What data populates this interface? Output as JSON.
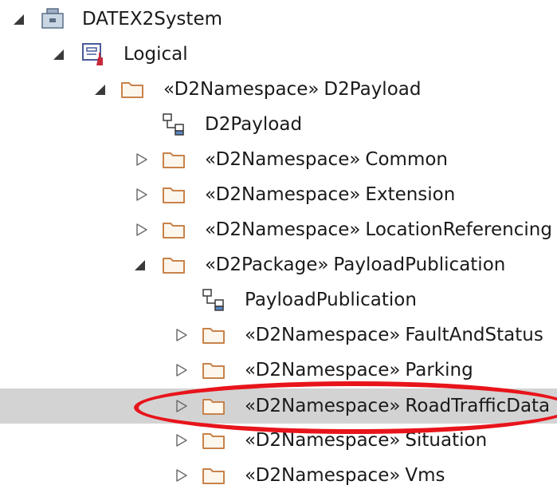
{
  "tree": {
    "root": {
      "label": "DATEX2System",
      "icon": "model-root-icon"
    },
    "logical": {
      "label": "Logical",
      "icon": "logical-view-icon"
    },
    "d2payload_pkg": {
      "stereotype": "«D2Namespace»",
      "name": "D2Payload",
      "icon": "folder-icon"
    },
    "d2payload_diagram": {
      "label": "D2Payload",
      "icon": "class-diagram-icon"
    },
    "common": {
      "stereotype": "«D2Namespace»",
      "name": "Common",
      "icon": "folder-icon"
    },
    "extension": {
      "stereotype": "«D2Namespace»",
      "name": "Extension",
      "icon": "folder-icon"
    },
    "location_referencing": {
      "stereotype": "«D2Namespace»",
      "name": "LocationReferencing",
      "icon": "folder-icon"
    },
    "payload_publication_pkg": {
      "stereotype": "«D2Package»",
      "name": "PayloadPublication",
      "icon": "folder-icon"
    },
    "payload_publication_diagram": {
      "label": "PayloadPublication",
      "icon": "class-diagram-icon"
    },
    "fault_and_status": {
      "stereotype": "«D2Namespace»",
      "name": "FaultAndStatus",
      "icon": "folder-icon"
    },
    "parking": {
      "stereotype": "«D2Namespace»",
      "name": "Parking",
      "icon": "folder-icon"
    },
    "road_traffic_data": {
      "stereotype": "«D2Namespace»",
      "name": "RoadTrafficData",
      "icon": "folder-icon",
      "selected": true
    },
    "situation": {
      "stereotype": "«D2Namespace»",
      "name": "Situation",
      "icon": "folder-icon"
    },
    "vms": {
      "stereotype": "«D2Namespace»",
      "name": "Vms",
      "icon": "folder-icon"
    }
  },
  "colors": {
    "selection": "#d3d3d3",
    "highlight": "#e8141b",
    "folder": "#c8824a",
    "twisty_expanded": "#3a3a3a",
    "twisty_collapsed": "#6e6e6e"
  }
}
